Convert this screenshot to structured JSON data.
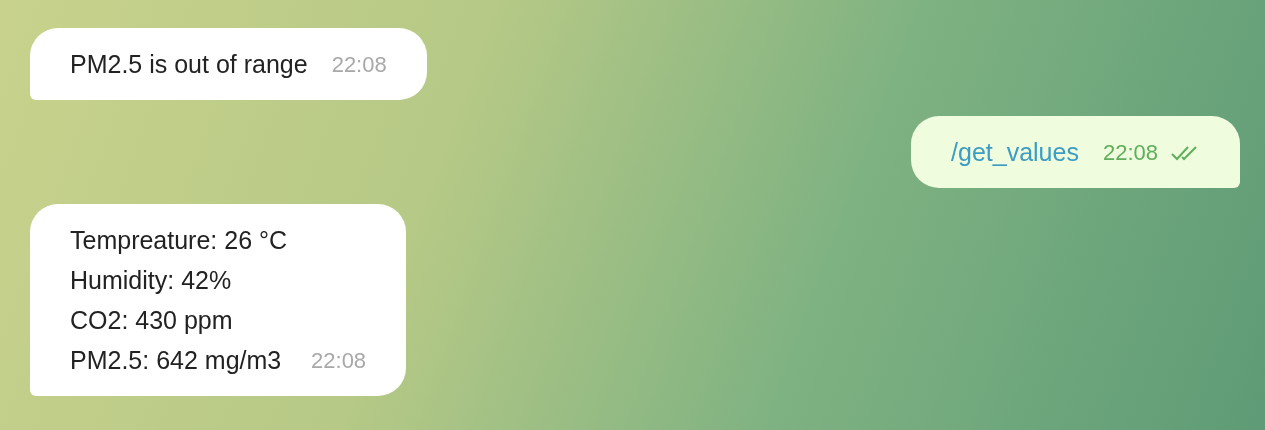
{
  "messages": [
    {
      "kind": "incoming",
      "lines": [
        "PM2.5 is out of range"
      ],
      "time": "22:08"
    },
    {
      "kind": "outgoing",
      "command": true,
      "lines": [
        "/get_values"
      ],
      "time": "22:08",
      "read": true
    },
    {
      "kind": "incoming",
      "lines": [
        "Tempreature: 26 °C",
        "Humidity: 42%",
        "CO2: 430 ppm",
        "PM2.5: 642 mg/m3"
      ],
      "time": "22:08"
    }
  ]
}
